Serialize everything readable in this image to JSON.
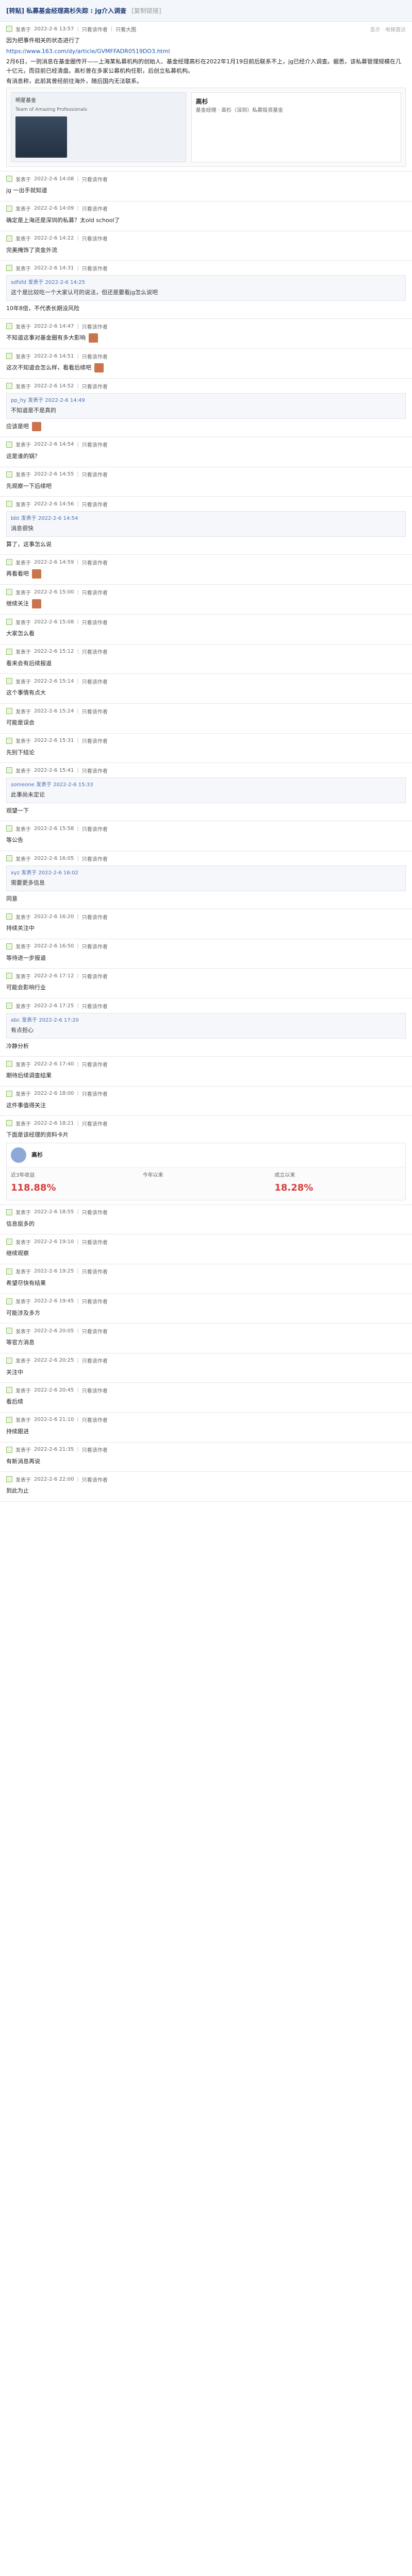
{
  "topbar": {
    "title": "[转贴] 私募基金经理高杉失踪 : jg介入调查",
    "tag": "[复制链接]"
  },
  "posts": [
    {
      "meta": {
        "author": "发表于",
        "time": "2022-2-6 13:57",
        "action1": "只看该作者",
        "action2": "只看大图",
        "right": "显示 · 电梯直达"
      },
      "lines": [
        "因为把事件相关的状态进行了",
        "https://www.163.com/dy/article/GVMFFADR0519DO3.html",
        "2月6日，一则消息在基金圈传开——上海某私募机构的创始人、基金经理高杉在2022年1月19日前后联系不上，jg已经介入调查。据悉，该私募管理规模在几十亿元，而目前已经清盘。高杉曾在多家公募机构任职，后创立私募机构。",
        "有消息称，此前其曾经前往海外，随后国内无法联系。"
      ],
      "card": {
        "left_title": "明星基金",
        "left_sub": "Team of Amazing Professionals",
        "right_name": "高杉",
        "right_sub": "基金经理 · 高杉（深圳）私募投资基金"
      }
    },
    {
      "meta": {
        "author": "发表于",
        "time": "2022-2-6 14:08",
        "action1": "只看该作者",
        "right": ""
      },
      "lines": [
        "jg 一出手就知道"
      ]
    },
    {
      "meta": {
        "author": "发表于",
        "time": "2022-2-6 14:09",
        "action1": "只看该作者",
        "right": ""
      },
      "lines": [
        "确定是上海还是深圳的私募？太old school了"
      ]
    },
    {
      "meta": {
        "author": "发表于",
        "time": "2022-2-6 14:22",
        "action1": "只看该作者",
        "right": ""
      },
      "lines": [
        "完美掩饰了资金外流"
      ]
    },
    {
      "meta": {
        "author": "发表于",
        "time": "2022-2-6 14:31",
        "action1": "只看该作者",
        "right": ""
      },
      "quote": {
        "head": "sdfsfd 发表于 2022-2-6 14:25",
        "text": "这个是比较吃一个大家认可的说法，但还是要看jg怎么说吧"
      },
      "lines": [
        "10年8倍，不代表长期没风险"
      ]
    },
    {
      "meta": {
        "author": "发表于",
        "time": "2022-2-6 14:47",
        "action1": "只看该作者",
        "right": ""
      },
      "lines": [
        "不知道这事对基金圈有多大影响"
      ],
      "thumb": true
    },
    {
      "meta": {
        "author": "发表于",
        "time": "2022-2-6 14:51",
        "action1": "只看该作者",
        "right": ""
      },
      "lines": [
        "这次不知道会怎么样，看看后续吧"
      ],
      "thumb": true
    },
    {
      "meta": {
        "author": "发表于",
        "time": "2022-2-6 14:52",
        "action1": "只看该作者",
        "right": ""
      },
      "quote": {
        "head": "pp_hy 发表于 2022-2-6 14:49",
        "text": "不知道是不是真的"
      },
      "lines": [
        "应该是吧"
      ],
      "thumb": true
    },
    {
      "meta": {
        "author": "发表于",
        "time": "2022-2-6 14:54",
        "action1": "只看该作者",
        "right": ""
      },
      "lines": [
        "这是谁的锅？"
      ]
    },
    {
      "meta": {
        "author": "发表于",
        "time": "2022-2-6 14:55",
        "action1": "只看该作者",
        "right": ""
      },
      "lines": [
        "先观察一下后续吧"
      ]
    },
    {
      "meta": {
        "author": "发表于",
        "time": "2022-2-6 14:56",
        "action1": "只看该作者",
        "right": ""
      },
      "quote": {
        "head": "bbt 发表于 2022-2-6 14:54",
        "text": "消息很快"
      },
      "lines": [
        "算了，这事怎么说"
      ]
    },
    {
      "meta": {
        "author": "发表于",
        "time": "2022-2-6 14:59",
        "action1": "只看该作者",
        "right": ""
      },
      "lines": [
        "再看看吧"
      ],
      "thumb": true
    },
    {
      "meta": {
        "author": "发表于",
        "time": "2022-2-6 15:00",
        "action1": "只看该作者",
        "right": ""
      },
      "lines": [
        "继续关注"
      ],
      "thumb": true
    },
    {
      "meta": {
        "author": "发表于",
        "time": "2022-2-6 15:08",
        "action1": "只看该作者",
        "right": ""
      },
      "lines": [
        "大家怎么看"
      ]
    },
    {
      "meta": {
        "author": "发表于",
        "time": "2022-2-6 15:12",
        "action1": "只看该作者",
        "right": ""
      },
      "lines": [
        "看来会有后续报道"
      ]
    },
    {
      "meta": {
        "author": "发表于",
        "time": "2022-2-6 15:14",
        "action1": "只看该作者",
        "right": ""
      },
      "lines": [
        "这个事情有点大"
      ]
    },
    {
      "meta": {
        "author": "发表于",
        "time": "2022-2-6 15:24",
        "action1": "只看该作者",
        "right": ""
      },
      "lines": [
        "可能是误会"
      ]
    },
    {
      "meta": {
        "author": "发表于",
        "time": "2022-2-6 15:31",
        "action1": "只看该作者",
        "right": ""
      },
      "lines": [
        "先别下结论"
      ]
    },
    {
      "meta": {
        "author": "发表于",
        "time": "2022-2-6 15:41",
        "action1": "只看该作者",
        "right": ""
      },
      "quote": {
        "head": "someone 发表于 2022-2-6 15:33",
        "text": "此事尚未定论"
      },
      "lines": [
        "观望一下"
      ]
    },
    {
      "meta": {
        "author": "发表于",
        "time": "2022-2-6 15:58",
        "action1": "只看该作者",
        "right": ""
      },
      "lines": [
        "等公告"
      ]
    },
    {
      "meta": {
        "author": "发表于",
        "time": "2022-2-6 16:05",
        "action1": "只看该作者",
        "right": ""
      },
      "quote": {
        "head": "xyz 发表于 2022-2-6 16:02",
        "text": "需要更多信息"
      },
      "lines": [
        "同意"
      ]
    },
    {
      "meta": {
        "author": "发表于",
        "time": "2022-2-6 16:20",
        "action1": "只看该作者",
        "right": ""
      },
      "lines": [
        "持续关注中"
      ]
    },
    {
      "meta": {
        "author": "发表于",
        "time": "2022-2-6 16:50",
        "action1": "只看该作者",
        "right": ""
      },
      "lines": [
        "等待进一步报道"
      ]
    },
    {
      "meta": {
        "author": "发表于",
        "time": "2022-2-6 17:12",
        "action1": "只看该作者",
        "right": ""
      },
      "lines": [
        "可能会影响行业"
      ]
    },
    {
      "meta": {
        "author": "发表于",
        "time": "2022-2-6 17:25",
        "action1": "只看该作者",
        "right": ""
      },
      "quote": {
        "head": "abc 发表于 2022-2-6 17:20",
        "text": "有点担心"
      },
      "lines": [
        "冷静分析"
      ]
    },
    {
      "meta": {
        "author": "发表于",
        "time": "2022-2-6 17:40",
        "action1": "只看该作者",
        "right": ""
      },
      "lines": [
        "期待后续调查结果"
      ]
    },
    {
      "meta": {
        "author": "发表于",
        "time": "2022-2-6 18:00",
        "action1": "只看该作者",
        "right": ""
      },
      "lines": [
        "这件事值得关注"
      ]
    },
    {
      "meta": {
        "author": "发表于",
        "time": "2022-2-6 18:21",
        "action1": "只看该作者",
        "right": ""
      },
      "lines": [
        "下面是该经理的资料卡片"
      ],
      "stats": {
        "name": "高杉",
        "metric1_label": "近3年收益",
        "metric1_val": "118.88%",
        "metric2_label": "今年以来",
        "metric2_val": "",
        "metric3_label": "成立以来",
        "metric3_val": "18.28%"
      }
    },
    {
      "meta": {
        "author": "发表于",
        "time": "2022-2-6 18:55",
        "action1": "只看该作者",
        "right": ""
      },
      "lines": [
        "信息挺多的"
      ]
    },
    {
      "meta": {
        "author": "发表于",
        "time": "2022-2-6 19:10",
        "action1": "只看该作者",
        "right": ""
      },
      "lines": [
        "继续观察"
      ]
    },
    {
      "meta": {
        "author": "发表于",
        "time": "2022-2-6 19:25",
        "action1": "只看该作者",
        "right": ""
      },
      "lines": [
        "希望尽快有结果"
      ]
    },
    {
      "meta": {
        "author": "发表于",
        "time": "2022-2-6 19:45",
        "action1": "只看该作者",
        "right": ""
      },
      "lines": [
        "可能涉及多方"
      ]
    },
    {
      "meta": {
        "author": "发表于",
        "time": "2022-2-6 20:05",
        "action1": "只看该作者",
        "right": ""
      },
      "lines": [
        "等官方消息"
      ]
    },
    {
      "meta": {
        "author": "发表于",
        "time": "2022-2-6 20:25",
        "action1": "只看该作者",
        "right": ""
      },
      "lines": [
        "关注中"
      ]
    },
    {
      "meta": {
        "author": "发表于",
        "time": "2022-2-6 20:45",
        "action1": "只看该作者",
        "right": ""
      },
      "lines": [
        "看后续"
      ]
    },
    {
      "meta": {
        "author": "发表于",
        "time": "2022-2-6 21:10",
        "action1": "只看该作者",
        "right": ""
      },
      "lines": [
        "持续跟进"
      ]
    },
    {
      "meta": {
        "author": "发表于",
        "time": "2022-2-6 21:35",
        "action1": "只看该作者",
        "right": ""
      },
      "lines": [
        "有新消息再说"
      ]
    },
    {
      "meta": {
        "author": "发表于",
        "time": "2022-2-6 22:00",
        "action1": "只看该作者",
        "right": ""
      },
      "lines": [
        "到此为止"
      ]
    }
  ]
}
